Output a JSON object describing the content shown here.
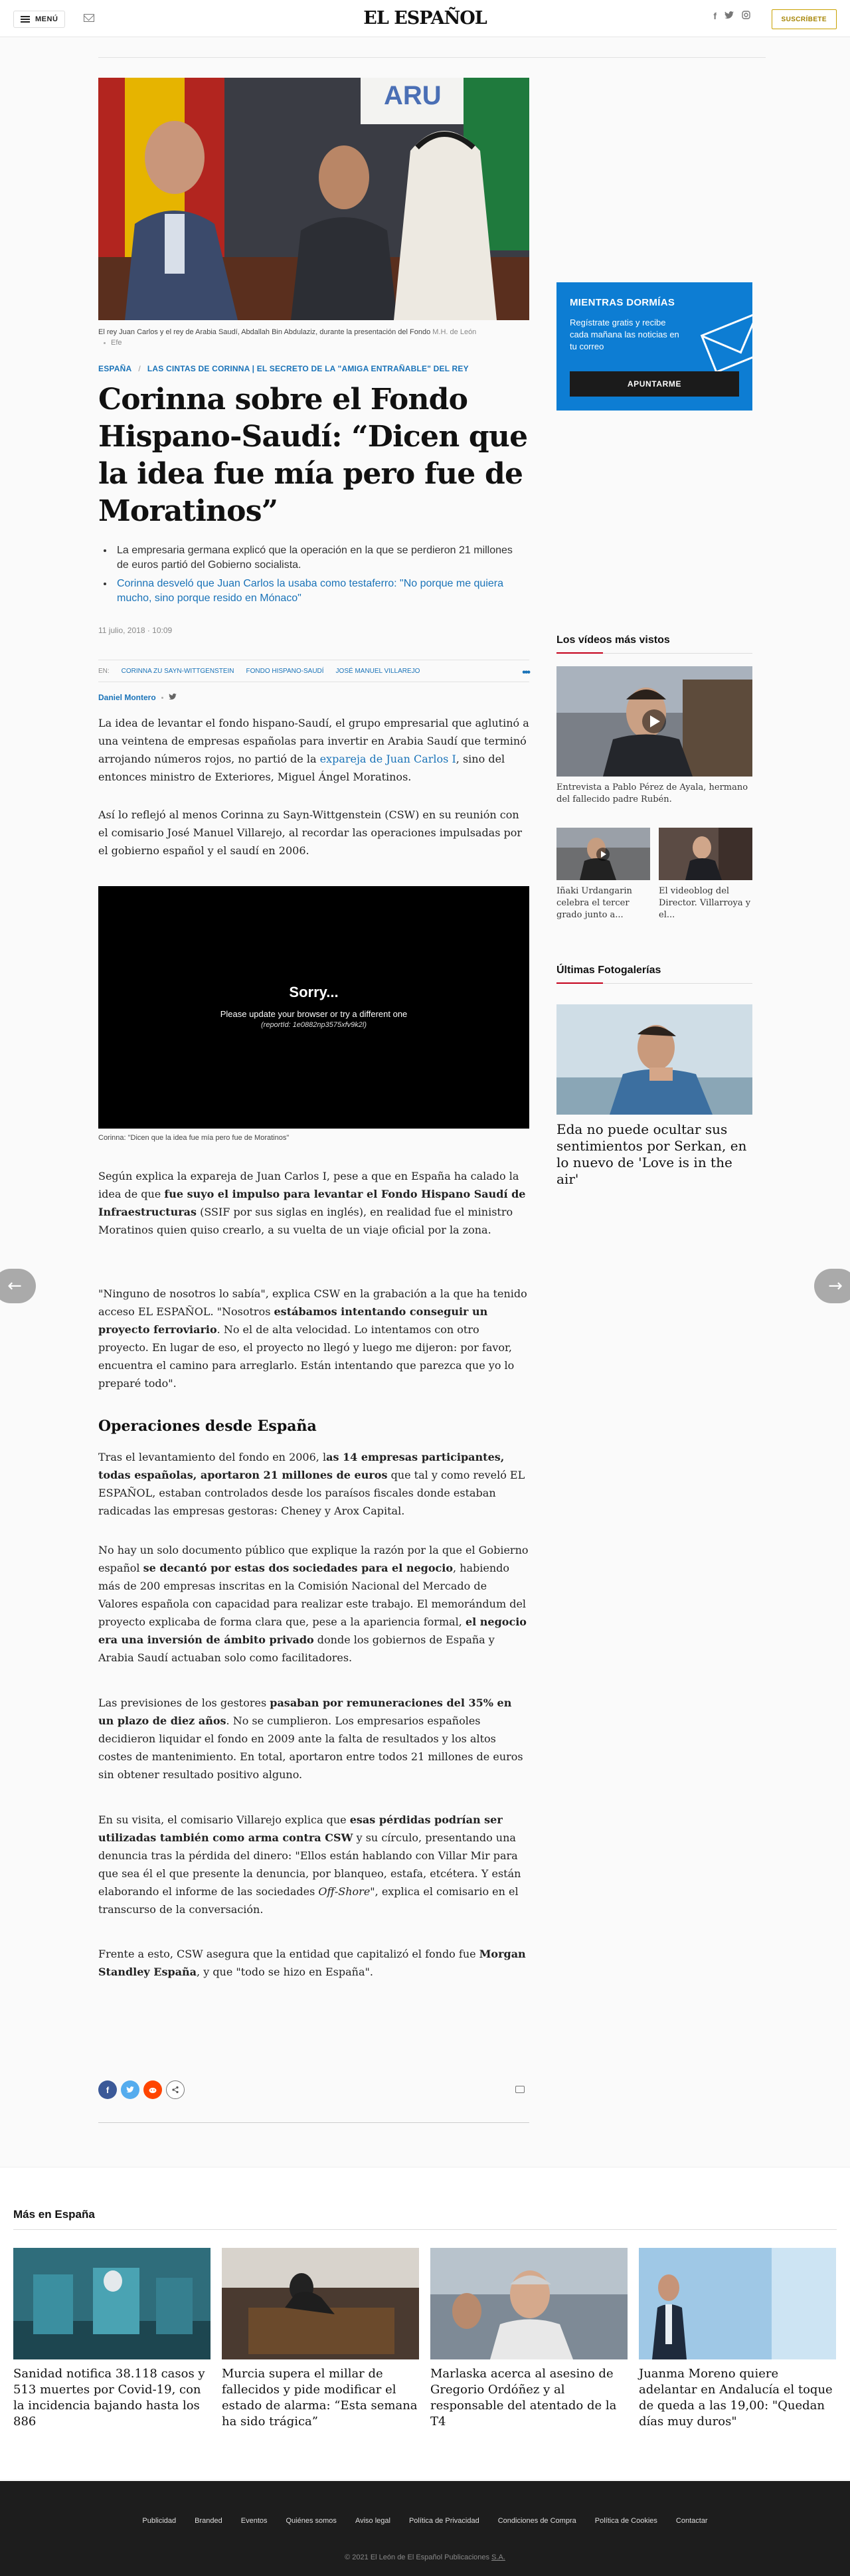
{
  "header": {
    "menu_label": "MENÚ",
    "logo": "EL ESPAÑOL",
    "social": [
      "f",
      "t",
      "ig"
    ],
    "subscribe_label": "SUSCRÍBETE"
  },
  "article": {
    "image_caption": "El rey Juan Carlos y el rey de Arabia Saudí, Abdallah Bin Abdulaziz, durante la presentación del Fondo",
    "image_credit": "M.H. de León",
    "image_source": "Efe",
    "section": "ESPAÑA",
    "topic": "LAS CINTAS DE CORINNA | EL SECRETO DE LA \"AMIGA ENTRAÑABLE\" DEL REY",
    "title": "Corinna sobre el Fondo Hispano-Saudí: “Dicen que la idea fue mía pero fue de Moratinos”",
    "summary": [
      "La empresaria germana explicó que la operación en la que se perdieron 21 millones de euros partió del Gobierno socialista.",
      "Corinna desveló que Juan Carlos la usaba como testaferro: \"No porque me quiera mucho, sino porque resido en Mónaco\""
    ],
    "date": "11 julio, 2018",
    "time": "10:09",
    "tags_prefix": "EN:",
    "tags": [
      "CORINNA ZU SAYN-WITTGENSTEIN",
      "FONDO HISPANO-SAUDÍ",
      "JOSÉ MANUEL VILLAREJO"
    ],
    "author": "Daniel Montero",
    "p1_a": "La idea de levantar el fondo hispano-Saudí, el grupo empresarial que aglutinó a una veintena de empresas españolas para invertir en Arabia Saudí que terminó arrojando números rojos, no partió de la ",
    "p1_link": "expareja de Juan Carlos I",
    "p1_b": ", sino del entonces ministro de Exteriores, Miguel Ángel Moratinos.",
    "p2": "Así lo reflejó al menos Corinna zu Sayn-Wittgenstein (CSW) en su reunión con el comisario José Manuel Villarejo, al recordar las operaciones impulsadas por el gobierno español y el saudí en 2006.",
    "video_sorry": "Sorry...",
    "video_msg": "Please update your browser or try a different one",
    "video_ref": "(reportId: 1e0882np3575xfv9k2l)",
    "video_caption": "Corinna: \"Dicen que la idea fue mía pero fue de Moratinos\"",
    "p3_a": "Según explica la expareja de Juan Carlos I, pese a que en España ha calado la idea de que ",
    "p3_b": "fue suyo el impulso para levantar el Fondo Hispano Saudí de Infraestructuras",
    "p3_c": " (SSIF por sus siglas en inglés), en realidad fue el ministro Moratinos quien quiso crearlo, a su vuelta de un viaje oficial por la zona.",
    "p4_a": "\"Ninguno de nosotros lo sabía\", explica CSW en la grabación a la que ha tenido acceso EL ESPAÑOL. \"Nosotros ",
    "p4_b": "estábamos intentando conseguir un proyecto ferroviario",
    "p4_c": ". No el de alta velocidad. Lo intentamos con otro proyecto. En lugar de eso, el proyecto no llegó y luego me dijeron: por favor, encuentra el camino para arreglarlo. Están intentando que parezca que yo lo preparé todo\".",
    "subhead": "Operaciones desde España",
    "p5_a": "Tras el levantamiento del fondo en 2006, l",
    "p5_b": "as 14 empresas participantes, todas españolas, aportaron 21 millones de euros",
    "p5_c": " que tal y como reveló EL ESPAÑOL, estaban controlados desde los paraísos fiscales donde estaban radicadas las empresas gestoras: Cheney y Arox Capital.",
    "p6_a": "No hay un solo documento público que explique la razón por la que el Gobierno español ",
    "p6_b": "se decantó por estas dos sociedades para el negocio",
    "p6_c": ", habiendo más de 200 empresas inscritas en la Comisión Nacional del Mercado de Valores española con capacidad para realizar este trabajo. El memorándum del proyecto explicaba de forma clara que, pese a la apariencia formal, ",
    "p6_d": "el negocio era una inversión de ámbito privado",
    "p6_e": " donde los gobiernos de España y Arabia Saudí actuaban solo como facilitadores.",
    "p7_a": "Las previsiones de los gestores ",
    "p7_b": "pasaban por remuneraciones del 35% en un plazo de diez años",
    "p7_c": ". No se cumplieron. Los empresarios españoles decidieron liquidar el fondo en 2009 ante la falta de resultados y los altos costes de mantenimiento. En total, aportaron entre todos 21 millones de euros sin obtener resultado positivo alguno.",
    "p8_a": "En su visita, el comisario Villarejo explica que ",
    "p8_b": "esas pérdidas podrían ser utilizadas también como arma contra CSW",
    "p8_c": " y su círculo, presentando una denuncia tras la pérdida del dinero: \"Ellos están hablando con Villar Mir para que sea él el que presente la denuncia, por blanqueo, estafa, etcétera. Y están elaborando el informe de las sociedades ",
    "p8_d": "Off-Shore",
    "p8_e": "\", explica el comisario en el transcurso de la conversación.",
    "p9_a": "Frente a esto, CSW asegura que la entidad que capitalizó el fondo fue ",
    "p9_b": "Morgan Standley España",
    "p9_c": ", y que \"todo se hizo en España\"."
  },
  "sidebar": {
    "promo_title": "MIENTRAS DORMÍAS",
    "promo_desc": "Regístrate gratis y recibe cada mañana las noticias en tu correo",
    "promo_button": "APUNTARME",
    "videos_title": "Los vídeos más vistos",
    "video_main_caption": "Entrevista a Pablo Pérez de Ayala, hermano del fallecido padre Rubén.",
    "video_small_1": "Iñaki Urdangarin celebra el tercer grado junto a...",
    "video_small_2": "El videoblog del Director. Villarroya y el...",
    "gallery_title": "Últimas Fotogalerías",
    "gallery_caption": "Eda no puede ocultar sus sentimientos por Serkan, en lo nuevo de 'Love is in the air'"
  },
  "more": {
    "title": "Más en España",
    "cards": [
      "Sanidad notifica 38.118 casos y 513 muertes por Covid-19, con la incidencia bajando hasta los 886",
      "Murcia supera el millar de fallecidos y pide modificar el estado de alarma: “Esta semana ha sido trágica”",
      "Marlaska acerca al asesino de Gregorio Ordóñez y al responsable del atentado de la T4",
      "Juanma Moreno quiere adelantar en Andalucía el toque de queda a las 19,00: \"Quedan días muy duros\""
    ]
  },
  "footer": {
    "links": [
      "Publicidad",
      "Branded",
      "Eventos",
      "Quiénes somos",
      "Aviso legal",
      "Política de Privacidad",
      "Condiciones de Compra",
      "Política de Cookies",
      "Contactar"
    ],
    "copyright_a": "© 2021 El León de El Español Publicaciones ",
    "copyright_b": "S.A."
  },
  "colors": {
    "link": "#1a73b8",
    "promo": "#0d7dd3",
    "accent_red": "#c4001a",
    "subscribe": "#c9a100"
  }
}
